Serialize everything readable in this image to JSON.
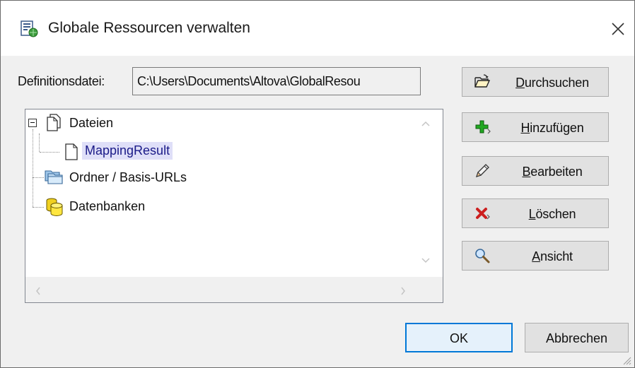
{
  "window": {
    "title": "Globale Ressourcen verwalten",
    "title_icon": "global-resources-icon",
    "close_glyph": "✕"
  },
  "definition": {
    "label": "Definitionsdatei:",
    "path": "C:\\Users\\Documents\\Altova\\GlobalResou"
  },
  "tree": {
    "items": [
      {
        "label": "Dateien",
        "icon": "files-icon",
        "expanded": true
      },
      {
        "label": "MappingResult",
        "icon": "file-icon",
        "selected": true
      },
      {
        "label": "Ordner / Basis-URLs",
        "icon": "folders-icon"
      },
      {
        "label": "Datenbanken",
        "icon": "databases-icon"
      }
    ]
  },
  "buttons": {
    "browse": {
      "prefix": "",
      "underline": "D",
      "rest": "urchsuchen",
      "icon": "open-folder-icon"
    },
    "add": {
      "prefix": "",
      "underline": "H",
      "rest": "inzufügen",
      "icon": "plus-icon"
    },
    "edit": {
      "prefix": "",
      "underline": "B",
      "rest": "earbeiten",
      "icon": "pencil-icon"
    },
    "delete": {
      "prefix": "",
      "underline": "L",
      "rest": "öschen",
      "icon": "delete-icon"
    },
    "view": {
      "prefix": "",
      "underline": "A",
      "rest": "nsicht",
      "icon": "magnifier-icon",
      "disabled": true
    }
  },
  "footer": {
    "ok": "OK",
    "cancel": "Abbrechen"
  },
  "colors": {
    "accent": "#0078d7",
    "selection": "#dfdff8",
    "button_face": "#e1e1e1",
    "dialog_bg": "#f0f0f0"
  }
}
